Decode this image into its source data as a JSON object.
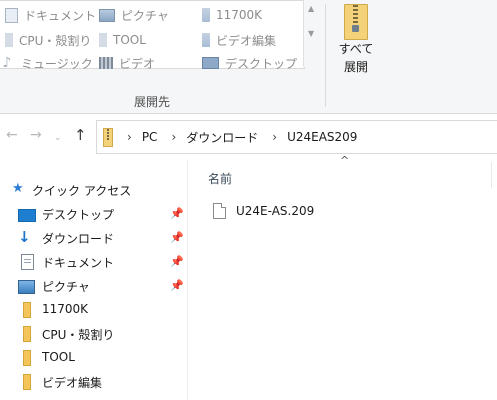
{
  "ribbon": {
    "gallery": {
      "items": [
        {
          "label": "ドキュメント",
          "icon": "document-icon"
        },
        {
          "label": "ピクチャ",
          "icon": "pictures-icon"
        },
        {
          "label": "11700K",
          "icon": "folder-icon"
        },
        {
          "label": "CPU・殻割り",
          "icon": "folder-icon"
        },
        {
          "label": "TOOL",
          "icon": "folder-icon"
        },
        {
          "label": "ビデオ編集",
          "icon": "folder-icon"
        },
        {
          "label": "ミュージック",
          "icon": "music-icon"
        },
        {
          "label": "ビデオ",
          "icon": "videos-icon"
        },
        {
          "label": "デスクトップ",
          "icon": "desktop-icon"
        }
      ]
    },
    "section_label": "展開先",
    "extract_all": {
      "line1": "すべて",
      "line2": "展開"
    }
  },
  "address_bar": {
    "crumbs": [
      "PC",
      "ダウンロード",
      "U24EAS209"
    ]
  },
  "nav_pane": {
    "quick_access_label": "クイック アクセス",
    "items": [
      {
        "label": "デスクトップ",
        "icon": "desktop-icon",
        "pinned": true
      },
      {
        "label": "ダウンロード",
        "icon": "download-icon",
        "pinned": true
      },
      {
        "label": "ドキュメント",
        "icon": "document-icon",
        "pinned": true
      },
      {
        "label": "ピクチャ",
        "icon": "pictures-icon",
        "pinned": true
      },
      {
        "label": "11700K",
        "icon": "folder-icon",
        "pinned": false
      },
      {
        "label": "CPU・殻割り",
        "icon": "folder-icon",
        "pinned": false
      },
      {
        "label": "TOOL",
        "icon": "folder-icon",
        "pinned": false
      },
      {
        "label": "ビデオ編集",
        "icon": "folder-icon",
        "pinned": false
      }
    ]
  },
  "content": {
    "column_header": "名前",
    "files": [
      {
        "name": "U24E-AS.209",
        "icon": "file-icon"
      }
    ]
  },
  "glyphs": {
    "back": "←",
    "forward": "→",
    "up": "↑",
    "crumb_sep": "›",
    "pin": "📌",
    "star": "★",
    "caret_up": "^",
    "scroll_up": "▲",
    "scroll_down": "▼",
    "music": "♪",
    "down": "↓"
  }
}
